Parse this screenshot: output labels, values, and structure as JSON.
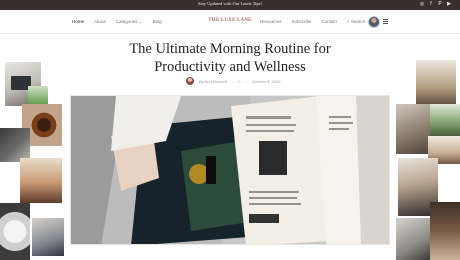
{
  "topbar": {
    "text": "Stay Updated with Our Latest Tips!"
  },
  "social": [
    "instagram-icon",
    "facebook-icon",
    "pinterest-icon",
    "youtube-icon"
  ],
  "nav": {
    "left_items": [
      {
        "label": "Home",
        "active": true
      },
      {
        "label": "About"
      },
      {
        "label": "Categories ⌄"
      },
      {
        "label": "Blog"
      }
    ],
    "logo": "THE LUXE LANE",
    "right_items": [
      {
        "label": "Resources"
      },
      {
        "label": "Subscribe"
      },
      {
        "label": "Contact"
      },
      {
        "label": "⌕ Search"
      }
    ]
  },
  "article": {
    "title_line1": "The Ultimate Morning Routine for",
    "title_line2": "Productivity and Wellness",
    "author": "By Ann Hoswell",
    "comments": "0",
    "date": "October 8, 2024"
  },
  "hero_image": {
    "subject": "hands-holding-open-magazine"
  },
  "colors": {
    "topbar": "#3a2f2f",
    "accent": "#b0625a",
    "text": "#222222"
  }
}
